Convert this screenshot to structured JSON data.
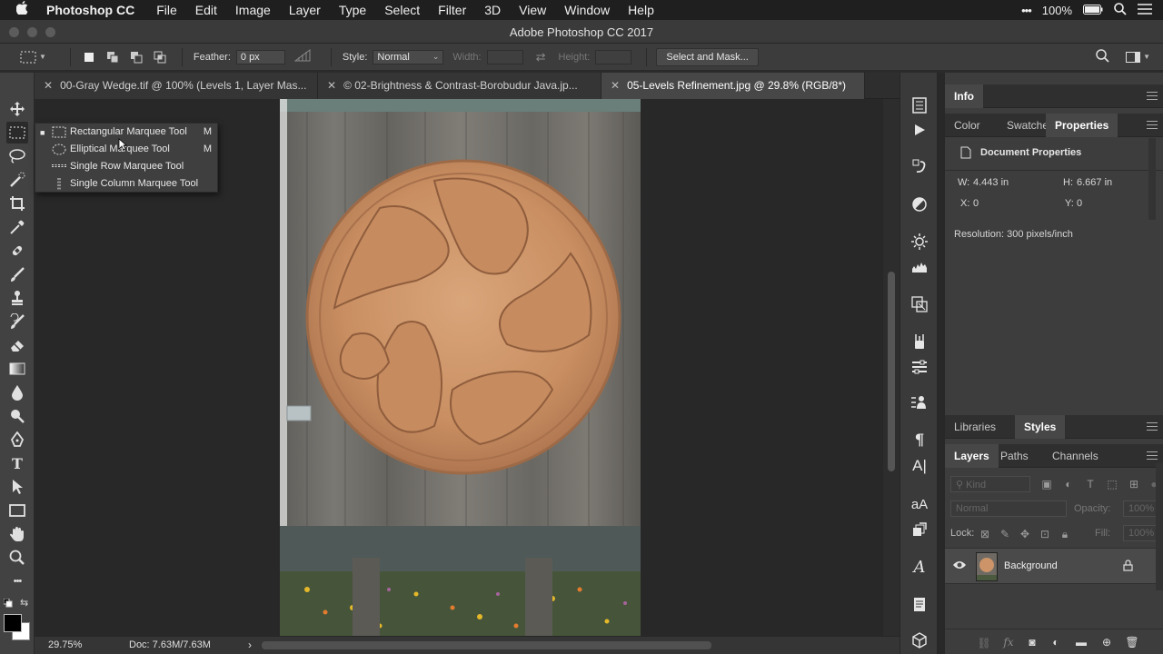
{
  "menubar": {
    "app": "Photoshop CC",
    "items": [
      "File",
      "Edit",
      "Image",
      "Layer",
      "Type",
      "Select",
      "Filter",
      "3D",
      "View",
      "Window",
      "Help"
    ],
    "battery": "100%"
  },
  "window": {
    "title": "Adobe Photoshop CC 2017"
  },
  "options": {
    "feather_label": "Feather:",
    "feather_value": "0 px",
    "style_label": "Style:",
    "style_value": "Normal",
    "width_label": "Width:",
    "height_label": "Height:",
    "select_mask": "Select and Mask..."
  },
  "tabs": [
    {
      "label": "00-Gray Wedge.tif @ 100% (Levels 1, Layer Mas..."
    },
    {
      "label": "© 02-Brightness & Contrast-Borobudur Java.jp..."
    },
    {
      "label": "05-Levels Refinement.jpg @ 29.8% (RGB/8*)"
    }
  ],
  "flyout": [
    {
      "label": "Rectangular Marquee Tool",
      "key": "M",
      "selected": true
    },
    {
      "label": "Elliptical Marquee Tool",
      "key": "M"
    },
    {
      "label": "Single Row Marquee Tool",
      "key": ""
    },
    {
      "label": "Single Column Marquee Tool",
      "key": ""
    }
  ],
  "status": {
    "zoom": "29.75%",
    "doc": "Doc: 7.63M/7.63M"
  },
  "panels": {
    "info_tab": "Info",
    "props_tabs": [
      "Color",
      "Swatches",
      "Properties"
    ],
    "doc_props_title": "Document Properties",
    "w_label": "W:",
    "w_value": "4.443 in",
    "h_label": "H:",
    "h_value": "6.667 in",
    "x_label": "X:",
    "x_value": "0",
    "y_label": "Y:",
    "y_value": "0",
    "resolution": "Resolution: 300 pixels/inch",
    "lib_tabs": [
      "Libraries",
      "Styles"
    ],
    "layer_tabs": [
      "Layers",
      "Paths",
      "Channels"
    ],
    "kind_label": "Kind",
    "blend_mode": "Normal",
    "opacity_label": "Opacity:",
    "opacity_value": "100%",
    "lock_label": "Lock:",
    "fill_label": "Fill:",
    "fill_value": "100%",
    "layer_name": "Background"
  },
  "colors": {
    "accent": "#474747",
    "canvas_bg": "#282828"
  }
}
